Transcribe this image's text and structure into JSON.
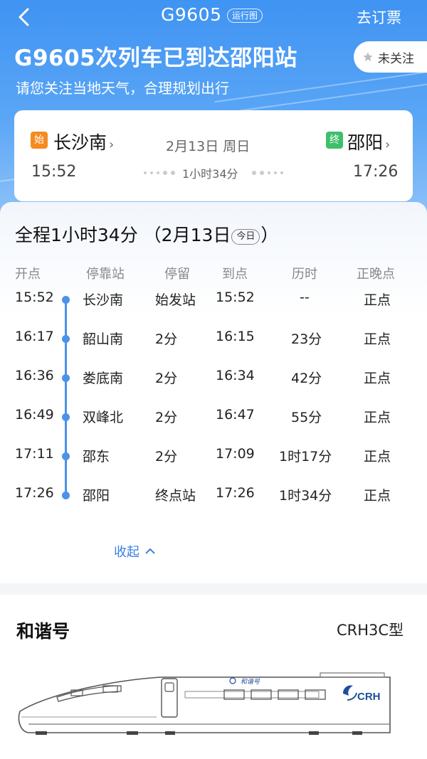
{
  "header": {
    "train_no": "G9605",
    "run_chart_label": "运行图",
    "order_label": "去订票",
    "headline": "G9605次列车已到达邵阳站",
    "subline": "请您关注当地天气，合理规划出行",
    "follow_label": "未关注",
    "icons": {
      "back": "back-arrow-icon",
      "star": "star-icon"
    }
  },
  "journey": {
    "from_tag": "始",
    "from_station": "长沙南",
    "from_time": "15:52",
    "to_tag": "终",
    "to_station": "邵阳",
    "to_time": "17:26",
    "date": "2月13日 周日",
    "duration": "1小时34分",
    "chevron": "›"
  },
  "schedule": {
    "total_prefix": "全程1小时34分  （2月13日",
    "today_badge": "今日",
    "total_suffix": "）",
    "columns": [
      "开点",
      "停靠站",
      "停留",
      "到点",
      "历时",
      "正晚点"
    ],
    "rows": [
      {
        "depart": "15:52",
        "station": "长沙南",
        "stop": "始发站",
        "arrive": "15:52",
        "elapsed": "--",
        "status": "正点"
      },
      {
        "depart": "16:17",
        "station": "韶山南",
        "stop": "2分",
        "arrive": "16:15",
        "elapsed": "23分",
        "status": "正点"
      },
      {
        "depart": "16:36",
        "station": "娄底南",
        "stop": "2分",
        "arrive": "16:34",
        "elapsed": "42分",
        "status": "正点"
      },
      {
        "depart": "16:49",
        "station": "双峰北",
        "stop": "2分",
        "arrive": "16:47",
        "elapsed": "55分",
        "status": "正点"
      },
      {
        "depart": "17:11",
        "station": "邵东",
        "stop": "2分",
        "arrive": "17:09",
        "elapsed": "1时17分",
        "status": "正点"
      },
      {
        "depart": "17:26",
        "station": "邵阳",
        "stop": "终点站",
        "arrive": "17:26",
        "elapsed": "1时34分",
        "status": "正点"
      }
    ],
    "collapse_label": "收起",
    "accent_color": "#4b92ea"
  },
  "train": {
    "name": "和谐号",
    "model": "CRH3C型",
    "body_text": "和谐号",
    "logo_text": "CRH"
  }
}
